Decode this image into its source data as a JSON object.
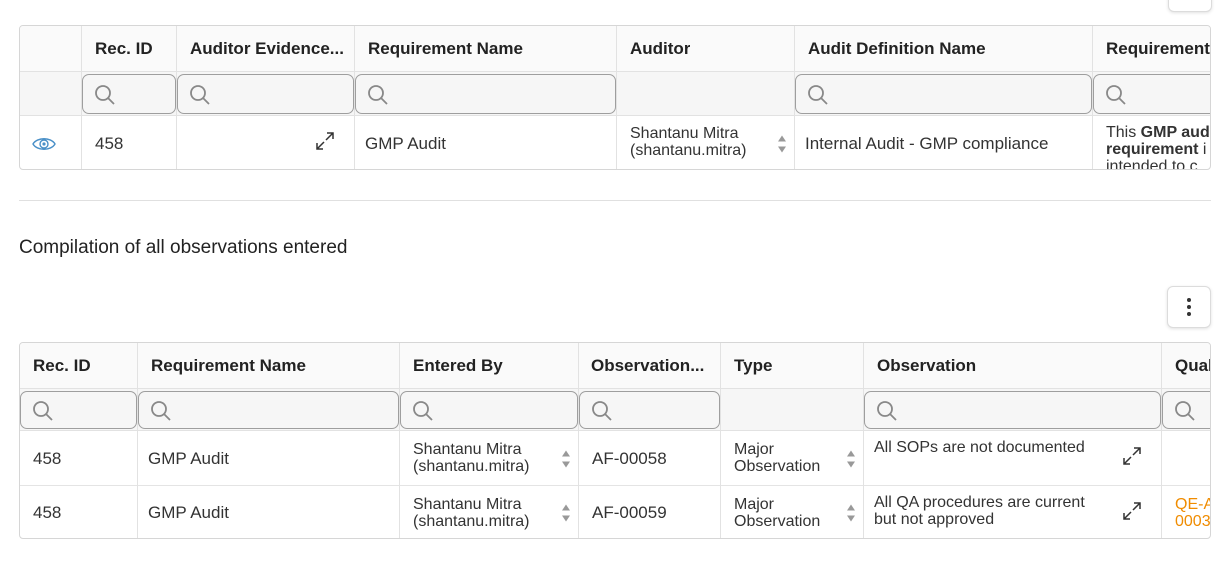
{
  "top_grid": {
    "columns": [
      "",
      "Rec. ID",
      "Auditor Evidence...",
      "Requirement Name",
      "Auditor",
      "Audit Definition Name",
      "Requirement"
    ],
    "row": {
      "rec_id": "458",
      "requirement_name": "GMP Audit",
      "auditor_line1": "Shantanu Mitra",
      "auditor_line2": "(shantanu.mitra)",
      "audit_definition_name": "Internal Audit - GMP compliance",
      "requirement_desc_prefix": "This ",
      "requirement_desc_bold1": "GMP aud",
      "requirement_desc_bold2": "requirement",
      "requirement_desc_rest2": " i",
      "requirement_desc_line3": "intended to c"
    }
  },
  "section": {
    "title": "Compilation of all observations entered"
  },
  "bottom_grid": {
    "columns": [
      "Rec. ID",
      "Requirement Name",
      "Entered By",
      "Observation...",
      "Type",
      "Observation",
      "Qual"
    ],
    "rows": [
      {
        "rec_id": "458",
        "requirement_name": "GMP Audit",
        "entered_by_line1": "Shantanu Mitra",
        "entered_by_line2": "(shantanu.mitra)",
        "observation_id": "AF-00058",
        "type_line1": "Major",
        "type_line2": "Observation",
        "observation_line1": "All SOPs are not documented",
        "observation_line2": "",
        "quality_line1": "",
        "quality_line2": ""
      },
      {
        "rec_id": "458",
        "requirement_name": "GMP Audit",
        "entered_by_line1": "Shantanu Mitra",
        "entered_by_line2": "(shantanu.mitra)",
        "observation_id": "AF-00059",
        "type_line1": "Major",
        "type_line2": "Observation",
        "observation_line1": "All QA procedures are current",
        "observation_line2": "but not approved",
        "quality_line1": "QE-A",
        "quality_line2": "0003"
      }
    ]
  },
  "colors": {
    "accent_link": "#f08c00",
    "eye_icon": "#4a90c8"
  }
}
